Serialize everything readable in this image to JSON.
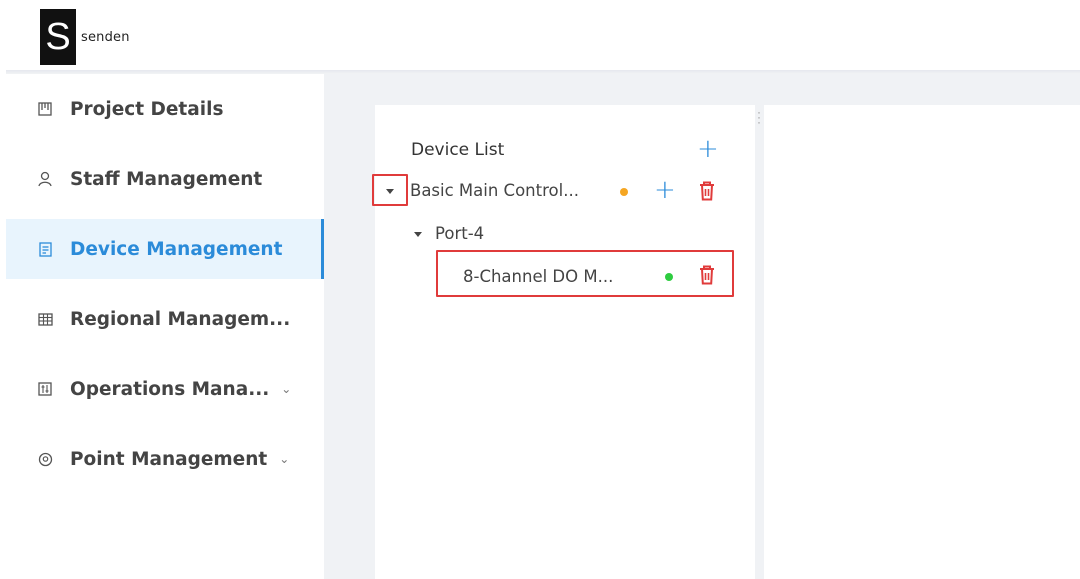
{
  "brand": {
    "logo_letter": "S",
    "logo_text": "senden"
  },
  "sidebar": {
    "items": [
      {
        "label": "Project Details",
        "icon": "project-details-icon"
      },
      {
        "label": "Staff Management",
        "icon": "user-icon"
      },
      {
        "label": "Device Management",
        "icon": "device-icon",
        "active": true
      },
      {
        "label": "Regional Managem...",
        "icon": "grid-icon"
      },
      {
        "label": "Operations Mana...",
        "icon": "sliders-icon",
        "chevron": "⌄"
      },
      {
        "label": "Point Management",
        "icon": "location-pin-icon",
        "chevron": "⌄"
      }
    ]
  },
  "device_panel": {
    "title": "Device List",
    "add_symbol": "+",
    "tree": {
      "root": {
        "label": "Basic Main Control...",
        "status_color": "#f5a623"
      },
      "port": {
        "label": "Port-4"
      },
      "child": {
        "label": "8-Channel DO M...",
        "status_color": "#2ecc40"
      }
    }
  },
  "colors": {
    "accent": "#2b8bd9",
    "danger": "#e03b3b",
    "warning_dot": "#f5a623",
    "online_dot": "#2ecc40"
  }
}
